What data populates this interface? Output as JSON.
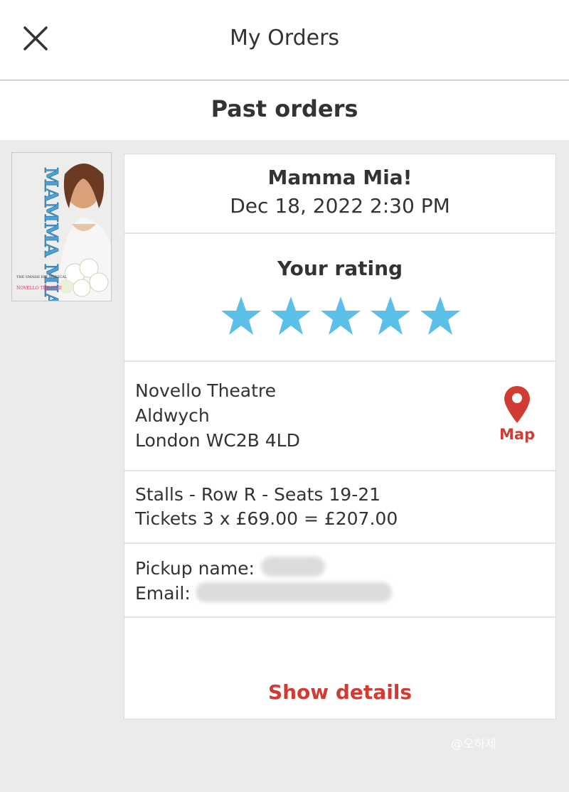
{
  "header": {
    "title": "My Orders",
    "close_icon": "close-icon"
  },
  "section": {
    "title": "Past orders"
  },
  "order": {
    "poster": {
      "title": "MAMMA MIA!",
      "subtitle": "THE SMASH HIT MUSICAL",
      "theatre": "NOVELLO THEATRE"
    },
    "show_name": "Mamma Mia!",
    "date_time": "Dec 18, 2022 2:30 PM",
    "rating": {
      "label": "Your rating",
      "value": 5,
      "max": 5,
      "star_color": "#5bc0e8"
    },
    "venue": {
      "line1": "Novello Theatre",
      "line2": "Aldwych",
      "line3": "London WC2B 4LD",
      "map_label": "Map",
      "map_icon": "map-pin-icon"
    },
    "seats": {
      "line1": "Stalls - Row R - Seats 19-21",
      "line2": "Tickets 3 x £69.00 = £207.00"
    },
    "contact": {
      "pickup_label": "Pickup name:",
      "email_label": "Email:"
    },
    "show_details_label": "Show details"
  },
  "watermark": "@오하제",
  "colors": {
    "accent": "#d03b33",
    "star": "#5bc0e8",
    "background": "#ebebeb"
  }
}
